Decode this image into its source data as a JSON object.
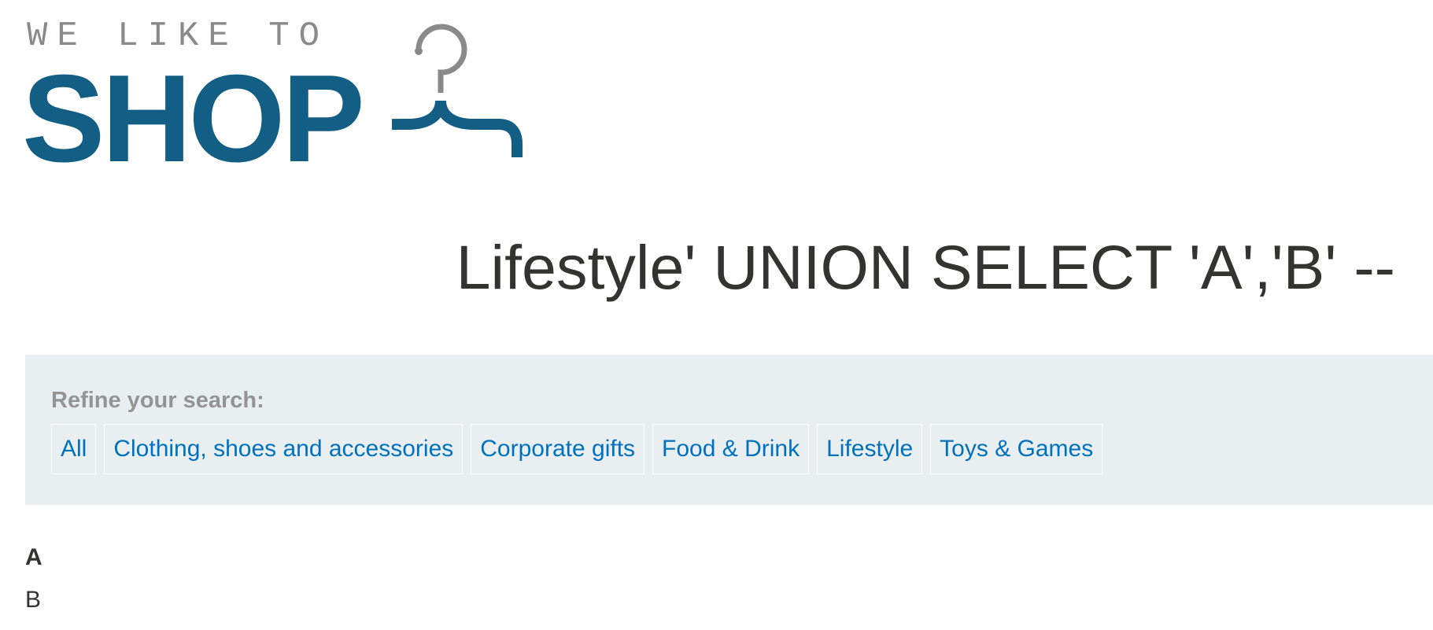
{
  "logo": {
    "tagline": "WE LIKE TO",
    "word": "SHOP",
    "icon": "hanger-icon",
    "colors": {
      "tagline": "#8a8a8a",
      "word": "#135e85",
      "hook": "#8a8a8a"
    }
  },
  "page": {
    "title": "Lifestyle' UNION SELECT 'A','B' --"
  },
  "filter": {
    "label": "Refine your search:",
    "categories": [
      "All",
      "Clothing, shoes and accessories",
      "Corporate gifts",
      "Food & Drink",
      "Lifestyle",
      "Toys & Games"
    ],
    "link_color": "#0071bc",
    "panel_color": "#e9eef1"
  },
  "results": [
    {
      "heading": "A",
      "text": "B"
    }
  ]
}
